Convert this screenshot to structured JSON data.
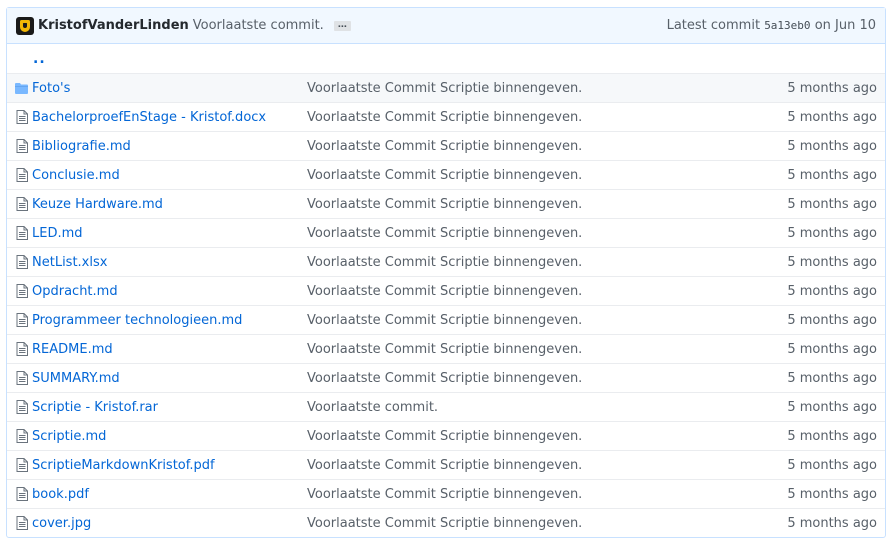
{
  "commit": {
    "author": "KristofVanderLinden",
    "message": "Voorlaatste commit.",
    "ellipsis": "…",
    "latest_prefix": "Latest commit",
    "sha": "5a13eb0",
    "date": "on Jun 10"
  },
  "parent_dir": "..",
  "rows": [
    {
      "type": "folder",
      "name": "Foto's",
      "message": "Voorlaatste Commit Scriptie binnengeven.",
      "age": "5 months ago"
    },
    {
      "type": "file",
      "name": "BachelorproefEnStage - Kristof.docx",
      "message": "Voorlaatste Commit Scriptie binnengeven.",
      "age": "5 months ago"
    },
    {
      "type": "file",
      "name": "Bibliografie.md",
      "message": "Voorlaatste Commit Scriptie binnengeven.",
      "age": "5 months ago"
    },
    {
      "type": "file",
      "name": "Conclusie.md",
      "message": "Voorlaatste Commit Scriptie binnengeven.",
      "age": "5 months ago"
    },
    {
      "type": "file",
      "name": "Keuze Hardware.md",
      "message": "Voorlaatste Commit Scriptie binnengeven.",
      "age": "5 months ago"
    },
    {
      "type": "file",
      "name": "LED.md",
      "message": "Voorlaatste Commit Scriptie binnengeven.",
      "age": "5 months ago"
    },
    {
      "type": "file",
      "name": "NetList.xlsx",
      "message": "Voorlaatste Commit Scriptie binnengeven.",
      "age": "5 months ago"
    },
    {
      "type": "file",
      "name": "Opdracht.md",
      "message": "Voorlaatste Commit Scriptie binnengeven.",
      "age": "5 months ago"
    },
    {
      "type": "file",
      "name": "Programmeer technologieen.md",
      "message": "Voorlaatste Commit Scriptie binnengeven.",
      "age": "5 months ago"
    },
    {
      "type": "file",
      "name": "README.md",
      "message": "Voorlaatste Commit Scriptie binnengeven.",
      "age": "5 months ago"
    },
    {
      "type": "file",
      "name": "SUMMARY.md",
      "message": "Voorlaatste Commit Scriptie binnengeven.",
      "age": "5 months ago"
    },
    {
      "type": "file",
      "name": "Scriptie - Kristof.rar",
      "message": "Voorlaatste commit.",
      "age": "5 months ago"
    },
    {
      "type": "file",
      "name": "Scriptie.md",
      "message": "Voorlaatste Commit Scriptie binnengeven.",
      "age": "5 months ago"
    },
    {
      "type": "file",
      "name": "ScriptieMarkdownKristof.pdf",
      "message": "Voorlaatste Commit Scriptie binnengeven.",
      "age": "5 months ago"
    },
    {
      "type": "file",
      "name": "book.pdf",
      "message": "Voorlaatste Commit Scriptie binnengeven.",
      "age": "5 months ago"
    },
    {
      "type": "file",
      "name": "cover.jpg",
      "message": "Voorlaatste Commit Scriptie binnengeven.",
      "age": "5 months ago"
    }
  ],
  "icons": {
    "folder": "folder-icon",
    "file": "file-icon"
  },
  "colors": {
    "link": "#0366d6",
    "header_bg": "#f1f8ff",
    "border": "#c8e1ff",
    "folder": "#79b8ff"
  }
}
